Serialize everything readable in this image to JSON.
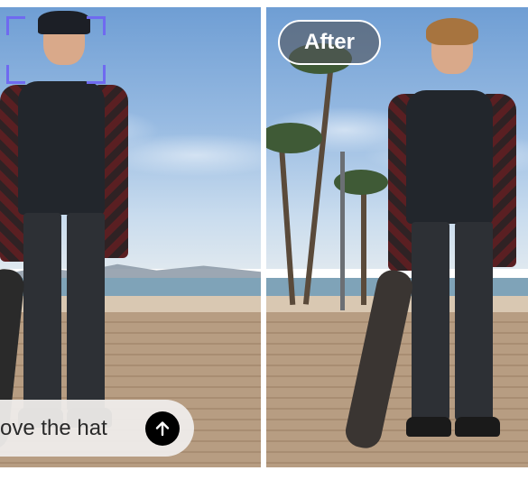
{
  "comparison": {
    "after_label": "After"
  },
  "prompt": {
    "text": "ove the hat",
    "send_icon": "arrow-up-icon"
  },
  "colors": {
    "crop_bracket": "#6f6af0",
    "send_button": "#000000"
  }
}
